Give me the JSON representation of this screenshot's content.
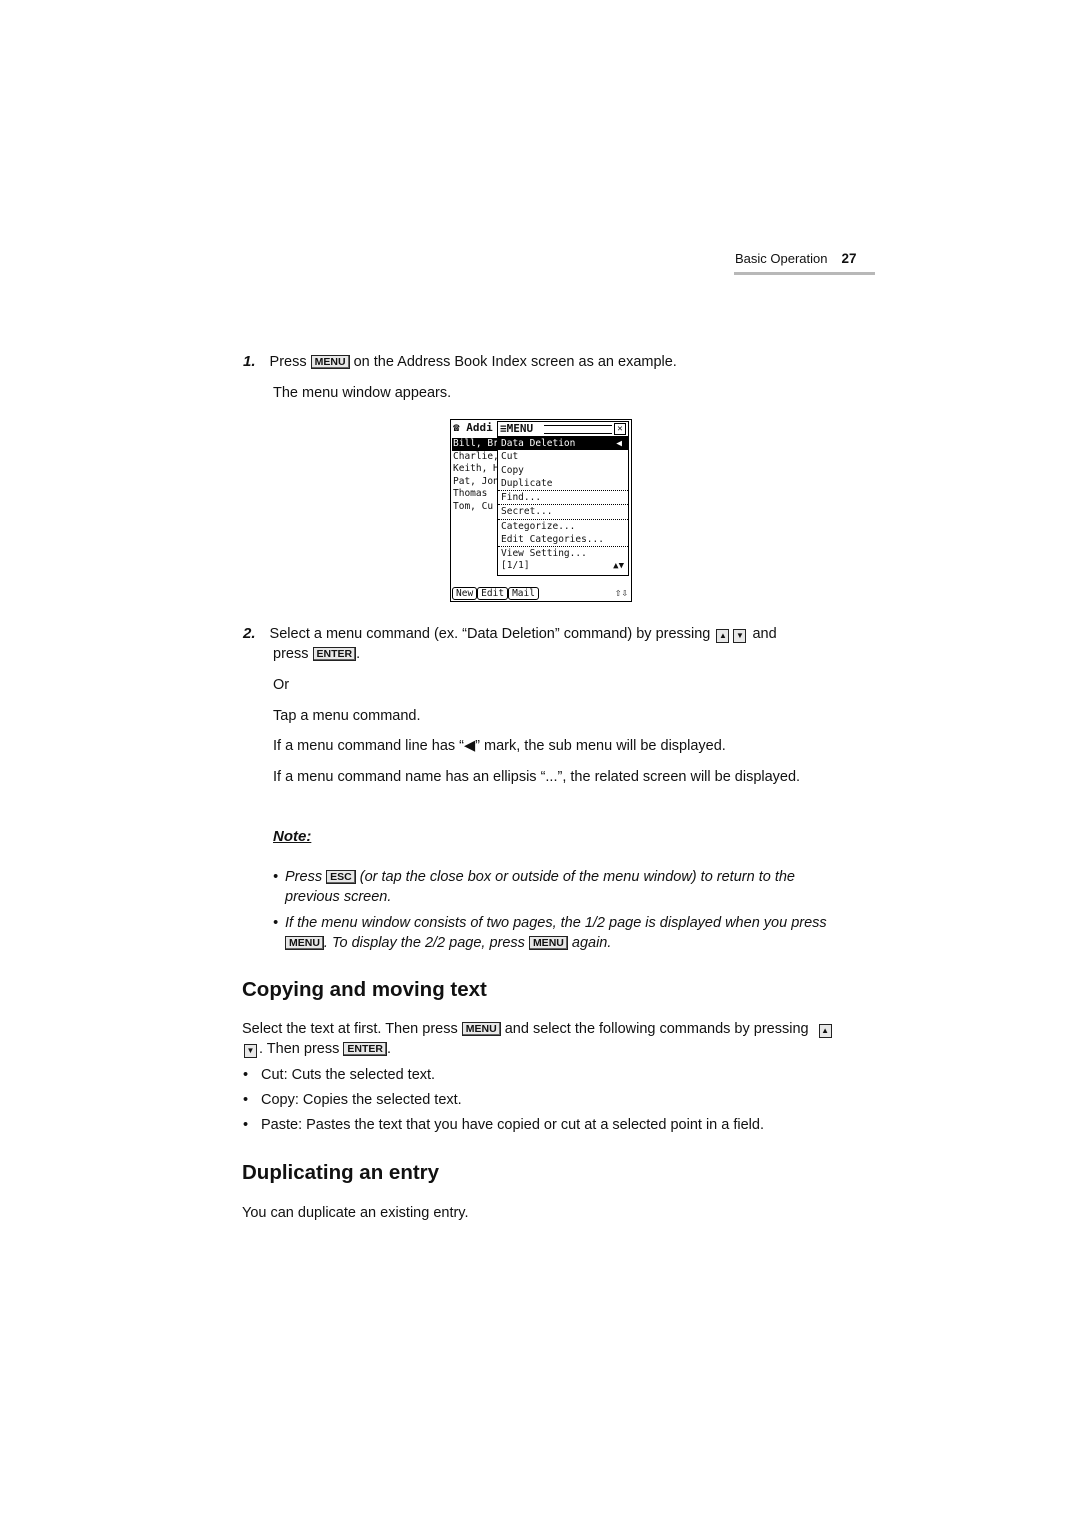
{
  "header": {
    "section": "Basic Operation",
    "page_number": "27"
  },
  "keys": {
    "menu": "MENU",
    "enter": "ENTER",
    "esc": "ESC",
    "up": "▲",
    "down": "▼"
  },
  "step1": {
    "number": "1.",
    "before_key": "Press",
    "after_key": "on the Address Book Index screen as an example.",
    "result": "The menu window appears."
  },
  "device": {
    "app_title": "Addi",
    "list": [
      "Bill, Bro",
      "Charlie,",
      "Keith, H.",
      "Pat, Jon",
      "Thomas",
      "Tom, Cu"
    ],
    "menu_title": "MENU",
    "menu_items": [
      {
        "label": "Data Deletion",
        "submenu": "◀"
      },
      {
        "label": "Cut"
      },
      {
        "label": "Copy"
      },
      {
        "label": "Duplicate"
      },
      {
        "label": "Find..."
      },
      {
        "label": "Secret..."
      },
      {
        "label": "Categorize..."
      },
      {
        "label": "Edit Categories..."
      },
      {
        "label": "View Setting..."
      }
    ],
    "pager": "[1/1]",
    "buttons": [
      "New",
      "Edit",
      "Mail"
    ]
  },
  "step2": {
    "number": "2.",
    "line1_before": "Select a menu command (ex. “Data Deletion” command) by pressing",
    "line1_after": "and",
    "line2_before": "press",
    "line2_after": ".",
    "or": "Or",
    "tap": "Tap a menu command.",
    "submenu_before": "If a menu command line has “",
    "submenu_mark": "◀",
    "submenu_after": "” mark, the sub menu will be displayed.",
    "ellipsis": "If a menu command name has an ellipsis “...”, the related screen will be displayed."
  },
  "note": {
    "label": "Note:",
    "item1_before": "Press",
    "item1_after": "(or tap the close box or outside of the menu window) to return to the previous screen.",
    "item2_before": "If the menu window consists of two pages, the 1/2 page is displayed when you press",
    "item2_mid": ". To display the 2/2 page, press",
    "item2_after": "again."
  },
  "copying": {
    "heading": "Copying and moving text",
    "intro_before": "Select the text at first. Then press",
    "intro_mid": "and select the following commands by pressing",
    "intro_mid2": ". Then press",
    "intro_after": ".",
    "bullets": [
      "Cut: Cuts the selected text.",
      "Copy: Copies the selected text.",
      "Paste: Pastes the text that you have copied or cut at a selected point in a field."
    ]
  },
  "duplicating": {
    "heading": "Duplicating an entry",
    "text": "You can duplicate an existing entry."
  }
}
